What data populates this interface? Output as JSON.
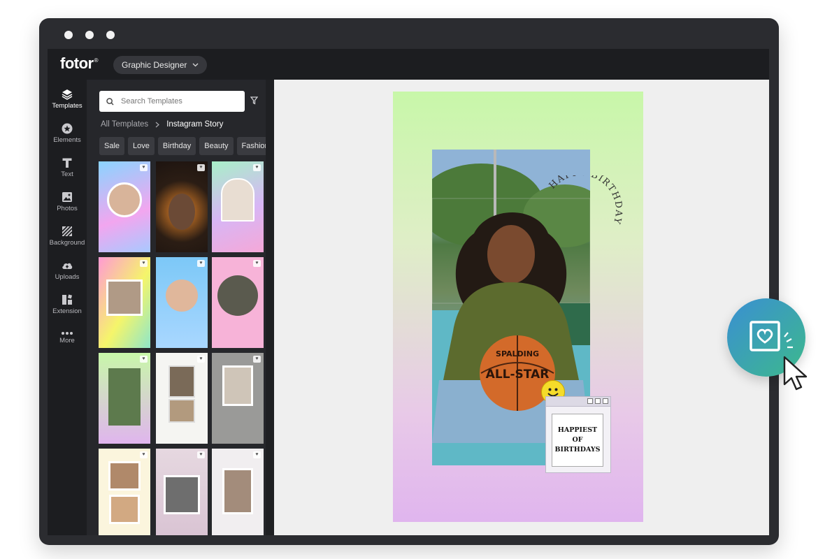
{
  "app": {
    "logo": "fotor",
    "logo_mark": "®",
    "mode_label": "Graphic Designer"
  },
  "rail": {
    "items": [
      {
        "label": "Templates",
        "icon": "layers-icon"
      },
      {
        "label": "Elements",
        "icon": "elements-icon"
      },
      {
        "label": "Text",
        "icon": "text-icon"
      },
      {
        "label": "Photos",
        "icon": "photos-icon"
      },
      {
        "label": "Background",
        "icon": "background-icon"
      },
      {
        "label": "Uploads",
        "icon": "upload-cloud-icon"
      },
      {
        "label": "Extension",
        "icon": "extension-icon"
      },
      {
        "label": "More",
        "icon": "more-dots-icon"
      }
    ]
  },
  "panel": {
    "search_placeholder": "Search Templates",
    "breadcrumb": {
      "root": "All Templates",
      "current": "Instagram Story"
    },
    "chips": [
      "Sale",
      "Love",
      "Birthday",
      "Beauty",
      "Fashion"
    ]
  },
  "story": {
    "arc_text": "HAPPY BIRTHDAY",
    "message": "HAPPIEST\nOF\nBIRTHDAYS",
    "ball_brand": "SPALDING",
    "ball_text": "ALL-STAR"
  },
  "colors": {
    "accent_gradient_start": "#3a8fd3",
    "accent_gradient_end": "#3db98c",
    "story_top": "#c8f7a9",
    "story_bottom": "#e0b5ee"
  }
}
